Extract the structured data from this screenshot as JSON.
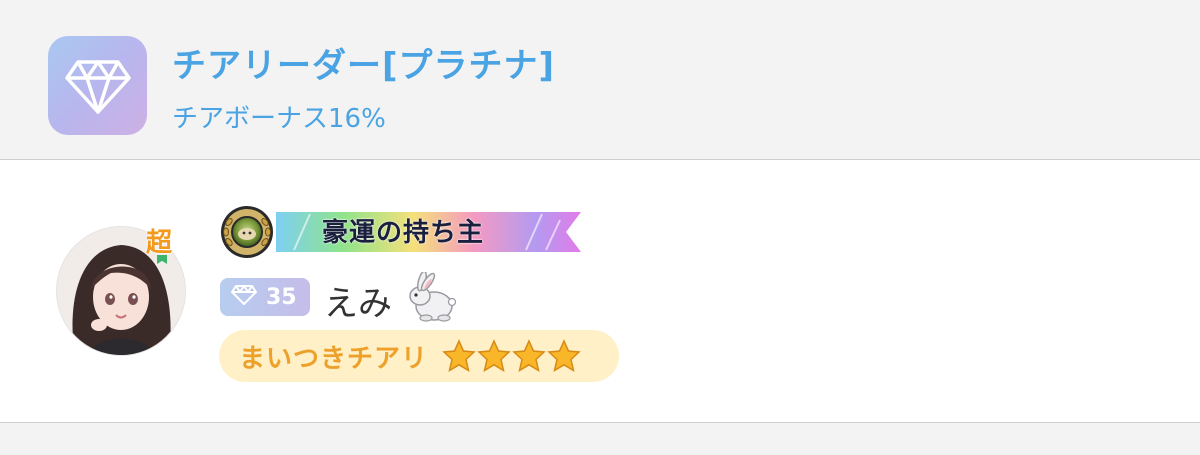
{
  "rank": {
    "title": "チアリーダー[プラチナ]",
    "bonus": "チアボーナス16%",
    "icon": "diamond-icon"
  },
  "user": {
    "avatar_tag": "超",
    "medal_icon": "medal-icon",
    "banner_title": "豪運の持ち主",
    "level": "35",
    "name": "えみ",
    "name_emoji": "rabbit-icon",
    "cheer_title": "まいつきチアリ",
    "stars": 4
  },
  "colors": {
    "accent_blue": "#4aa3e3",
    "title_orange": "#eda02a",
    "pill_bg": "#fff0c7",
    "band_bg": "#f3f3f4"
  }
}
